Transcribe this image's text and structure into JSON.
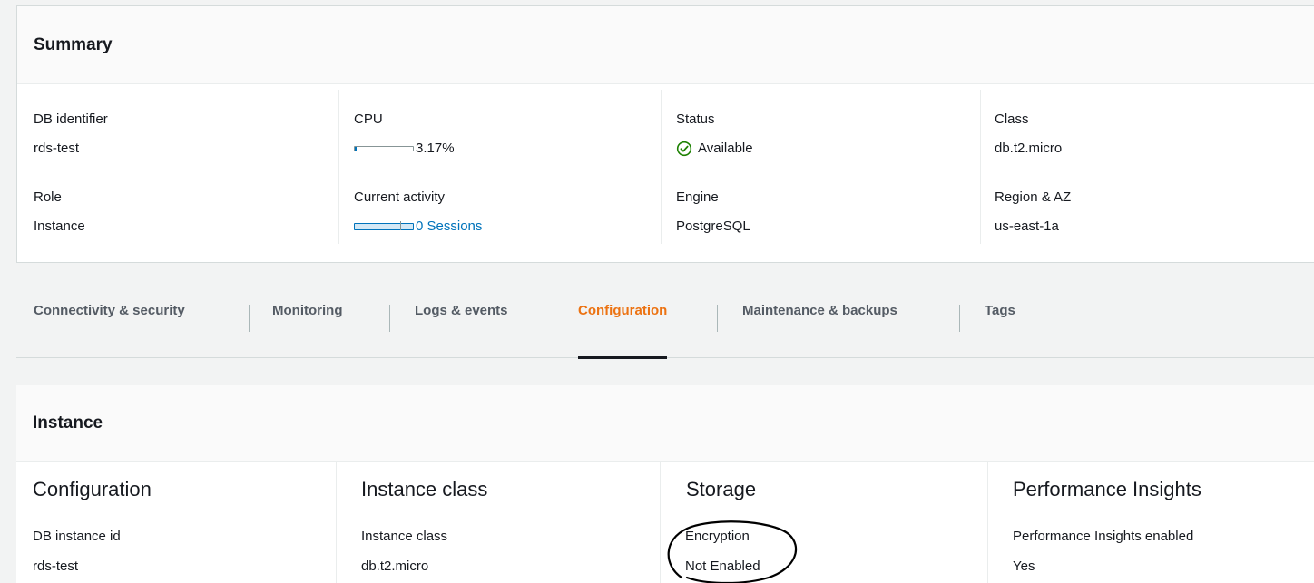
{
  "summary": {
    "title": "Summary",
    "db_identifier": {
      "label": "DB identifier",
      "value": "rds-test"
    },
    "role": {
      "label": "Role",
      "value": "Instance"
    },
    "cpu": {
      "label": "CPU",
      "value": "3.17%",
      "percent": 3.17
    },
    "current_activity": {
      "label": "Current activity",
      "value": "0 Sessions"
    },
    "status": {
      "label": "Status",
      "value": "Available",
      "icon": "check-circle-icon"
    },
    "engine": {
      "label": "Engine",
      "value": "PostgreSQL"
    },
    "class": {
      "label": "Class",
      "value": "db.t2.micro"
    },
    "region_az": {
      "label": "Region & AZ",
      "value": "us-east-1a"
    }
  },
  "tabs": [
    {
      "label": "Connectivity & security",
      "active": false
    },
    {
      "label": "Monitoring",
      "active": false
    },
    {
      "label": "Logs & events",
      "active": false
    },
    {
      "label": "Configuration",
      "active": true
    },
    {
      "label": "Maintenance & backups",
      "active": false
    },
    {
      "label": "Tags",
      "active": false
    }
  ],
  "instance": {
    "title": "Instance",
    "columns": [
      {
        "title": "Configuration",
        "field_label": "DB instance id",
        "field_value": "rds-test"
      },
      {
        "title": "Instance class",
        "field_label": "Instance class",
        "field_value": "db.t2.micro"
      },
      {
        "title": "Storage",
        "field_label": "Encryption",
        "field_value": "Not Enabled"
      },
      {
        "title": "Performance Insights",
        "field_label": "Performance Insights enabled",
        "field_value": "Yes"
      }
    ]
  },
  "colors": {
    "accent_link": "#0073bb",
    "status_ok": "#1d8102",
    "active_tab": "#ec7211"
  }
}
